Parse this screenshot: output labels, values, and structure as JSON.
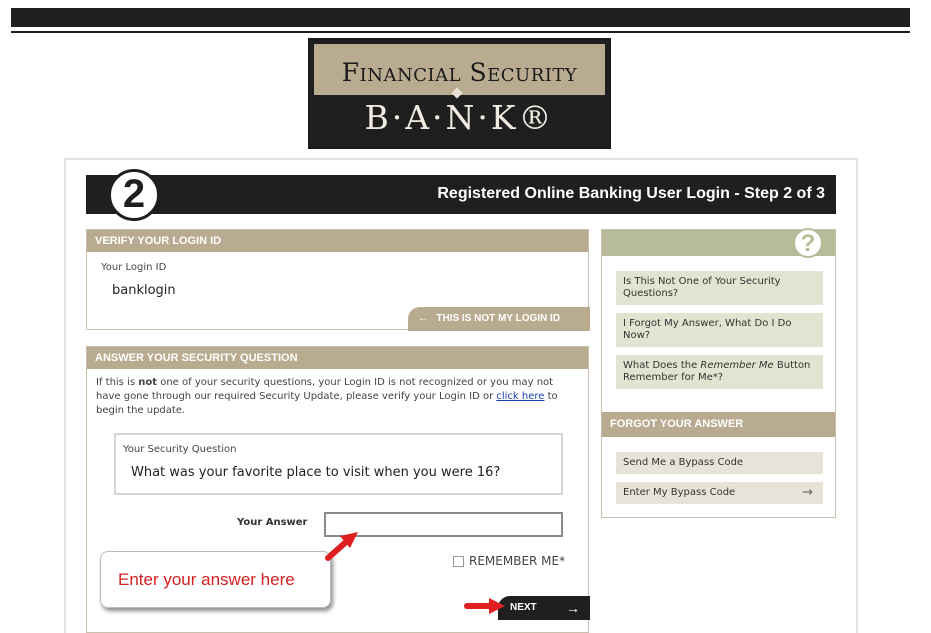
{
  "logo": {
    "line1": "Financial Security",
    "line2": "B·A·N·K®"
  },
  "step": {
    "number": "2",
    "title": "Registered Online Banking User Login - Step 2 of 3"
  },
  "verify": {
    "heading": "VERIFY YOUR LOGIN ID",
    "login_label": "Your Login ID",
    "login_value": "banklogin",
    "not_my_id": "THIS IS NOT MY LOGIN ID",
    "arrow": "←"
  },
  "answer": {
    "heading": "ANSWER YOUR SECURITY QUESTION",
    "info_pre": "If this is ",
    "info_bold": "not",
    "info_mid": " one of your security questions, your Login ID is not recognized or you may not have gone through our required Security Update, please verify your Login ID or ",
    "info_link": "click here",
    "info_post": " to begin the update.",
    "question_label": "Your Security Question",
    "question": "What was your favorite place to visit when you were 16?",
    "answer_label": "Your Answer",
    "answer_value": "",
    "remember_label": "REMEMBER ME*",
    "next_label": "NEXT",
    "next_arrow": "→"
  },
  "callout": {
    "text": "Enter your answer here"
  },
  "help": {
    "links": [
      "Is This Not One of Your Security Questions?",
      "I Forgot My Answer, What Do I Do Now?"
    ],
    "remember_pre": "What Does the ",
    "remember_em": "Remember Me",
    "remember_post": " Button Remember for Me*?",
    "forgot_heading": "FORGOT YOUR ANSWER",
    "bypass_send": "Send Me a Bypass Code",
    "bypass_enter": "Enter My Bypass Code",
    "arrow": "→",
    "icon": "?"
  },
  "colors": {
    "accent_tan": "#b9ab8f",
    "accent_sage": "#b8bb98",
    "dark": "#1f1f1f",
    "callout_text": "#d42020",
    "arrow": "#e02020"
  }
}
